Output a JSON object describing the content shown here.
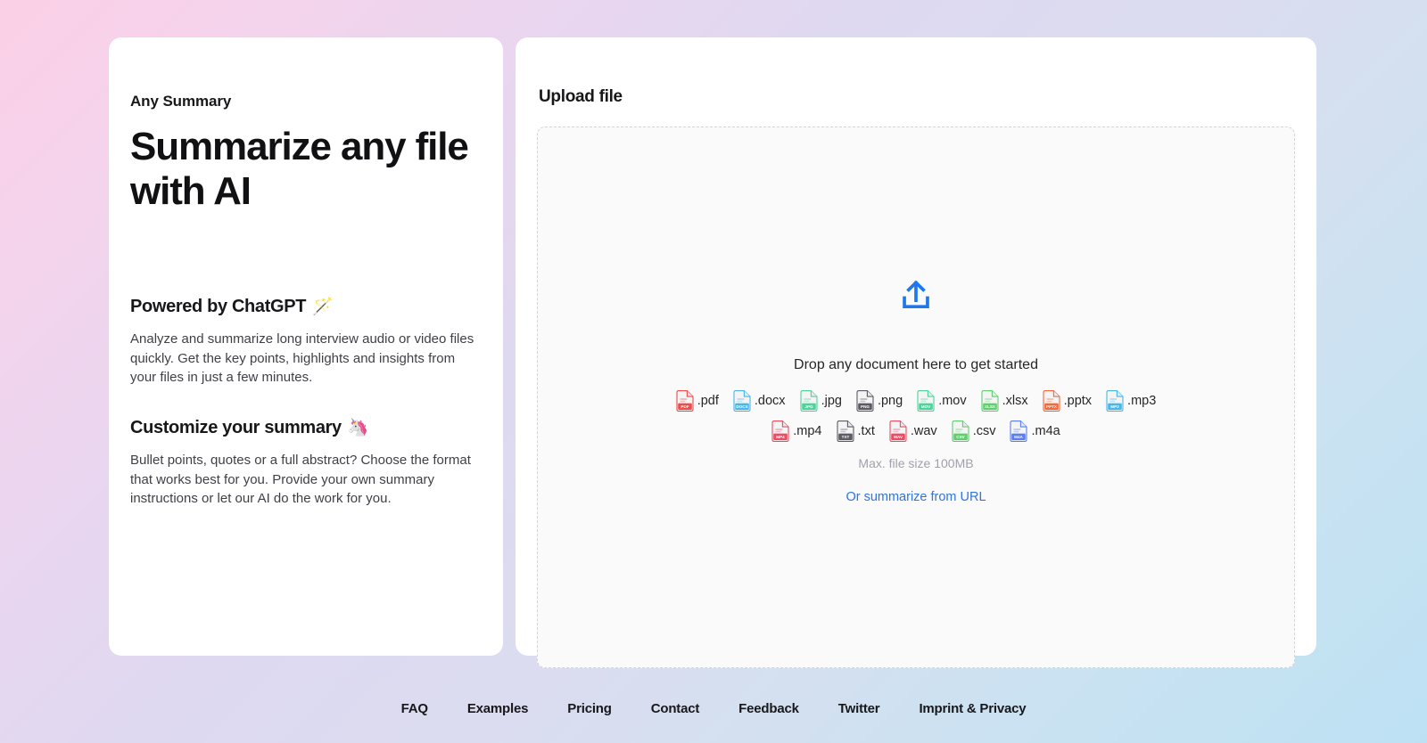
{
  "left_panel": {
    "eyebrow": "Any Summary",
    "hero_title": "Summarize any file with AI",
    "features": [
      {
        "title": "Powered by ChatGPT",
        "emoji": "🪄",
        "emoji_name": "magic-wand-emoji",
        "body": "Analyze and summarize long interview audio or video files quickly. Get the key points, highlights and insights from your files in just a few minutes."
      },
      {
        "title": "Customize your summary",
        "emoji": "🦄",
        "emoji_name": "unicorn-emoji",
        "body": "Bullet points, quotes or a full abstract? Choose the format that works best for you. Provide your own summary instructions or let our AI do the work for you."
      }
    ]
  },
  "upload_panel": {
    "heading": "Upload file",
    "upload_icon_name": "upload-icon",
    "upload_icon_color": "#1f77ed",
    "drop_text": "Drop any document here to get started",
    "max_size_text": "Max. file size 100MB",
    "url_link_label": "Or summarize from URL",
    "url_link_color": "#2f74e0",
    "formats": [
      {
        "label": ".pdf",
        "badge": "PDF",
        "color": "#ee4b4b",
        "tint": "#fde8e8"
      },
      {
        "label": ".docx",
        "badge": "DOCX",
        "color": "#4ab6e8",
        "tint": "#e4f3fb"
      },
      {
        "label": ".jpg",
        "badge": "JPG",
        "color": "#4ed39a",
        "tint": "#e3f8ef"
      },
      {
        "label": ".png",
        "badge": "PNG",
        "color": "#5b5b64",
        "tint": "#ebebee"
      },
      {
        "label": ".mov",
        "badge": "MOV",
        "color": "#4ed39a",
        "tint": "#e3f8ef"
      },
      {
        "label": ".xlsx",
        "badge": "XLSX",
        "color": "#5fce6f",
        "tint": "#e6f9e8"
      },
      {
        "label": ".pptx",
        "badge": "PPTX",
        "color": "#f4683a",
        "tint": "#fdeae3"
      },
      {
        "label": ".mp3",
        "badge": "MP3",
        "color": "#4ab6e8",
        "tint": "#e4f3fb"
      },
      {
        "label": ".mp4",
        "badge": "MP4",
        "color": "#ee4b63",
        "tint": "#fde8ec"
      },
      {
        "label": ".txt",
        "badge": "TXT",
        "color": "#5b5b64",
        "tint": "#ebebee"
      },
      {
        "label": ".wav",
        "badge": "WAV",
        "color": "#ee4b63",
        "tint": "#fde8ec"
      },
      {
        "label": ".csv",
        "badge": "CSV",
        "color": "#5fce6f",
        "tint": "#e6f9e8"
      },
      {
        "label": ".m4a",
        "badge": "M4A",
        "color": "#5a7ef0",
        "tint": "#e7ecfd"
      }
    ]
  },
  "footer": {
    "links": [
      "FAQ",
      "Examples",
      "Pricing",
      "Contact",
      "Feedback",
      "Twitter",
      "Imprint & Privacy"
    ]
  }
}
